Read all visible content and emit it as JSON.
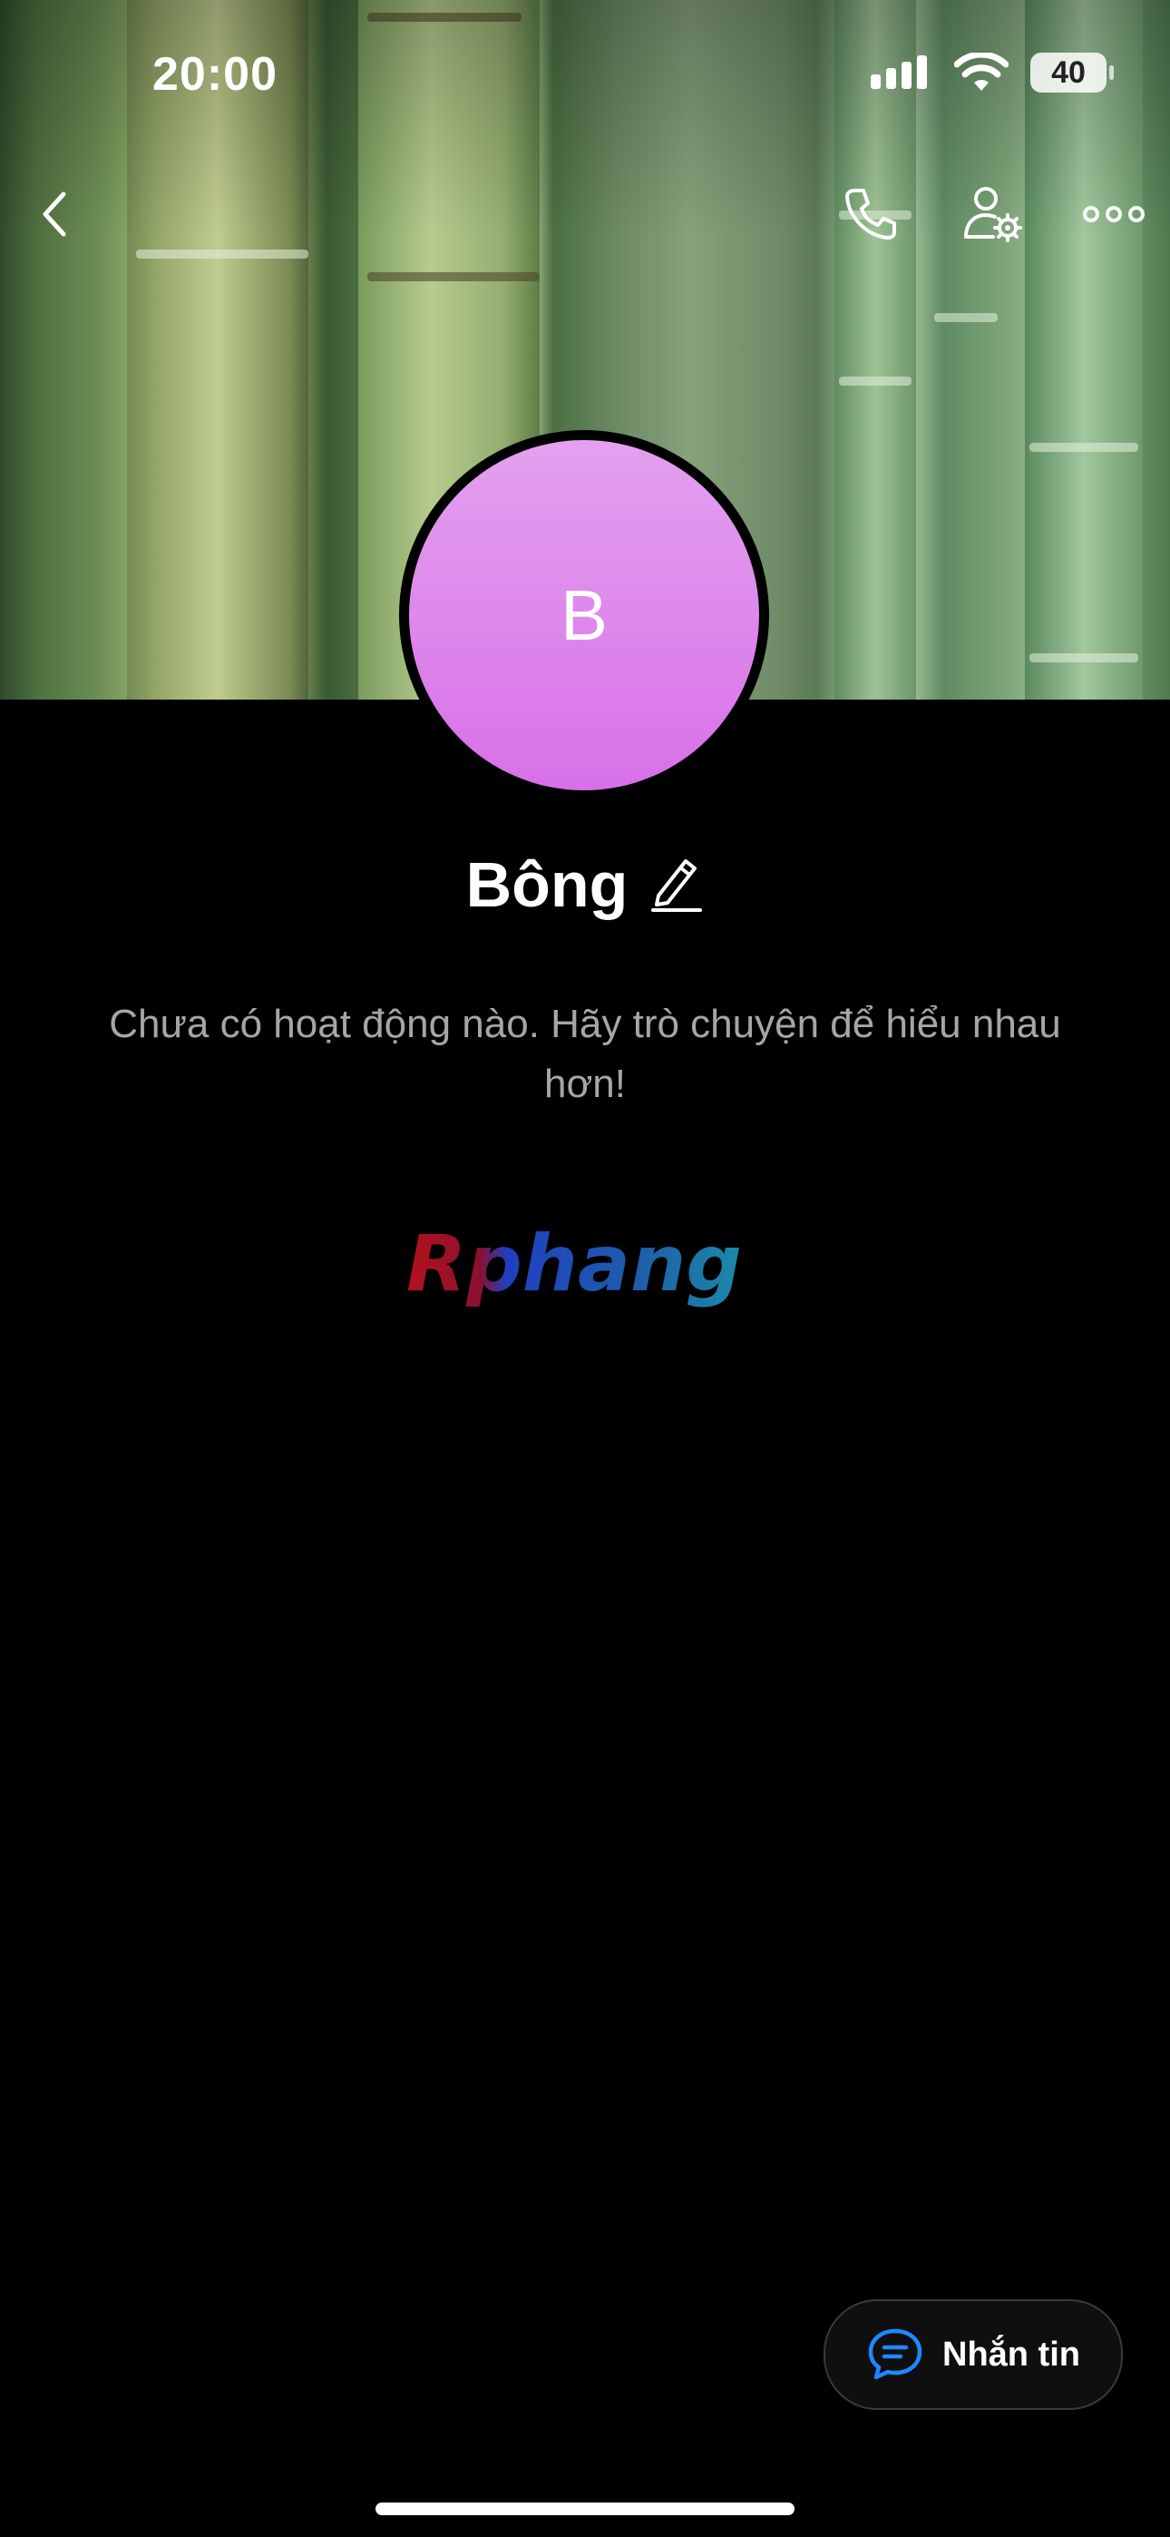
{
  "status_bar": {
    "time": "20:00",
    "battery": "40"
  },
  "header": {
    "back_icon": "chevron-left-icon",
    "call_icon": "phone-icon",
    "profile_settings_icon": "user-gear-icon",
    "more_icon": "ellipsis-icon"
  },
  "profile": {
    "avatar_initial": "B",
    "avatar_color": "#d870e8",
    "name": "Bông",
    "edit_icon": "pencil-icon",
    "activity_message": "Chưa có hoạt động nào. Hãy trò chuyện để hiểu nhau hơn!"
  },
  "watermark": {
    "text": "Rphang"
  },
  "message_button": {
    "label": "Nhắn tin",
    "icon": "chat-bubble-icon",
    "accent": "#1e88ff"
  }
}
